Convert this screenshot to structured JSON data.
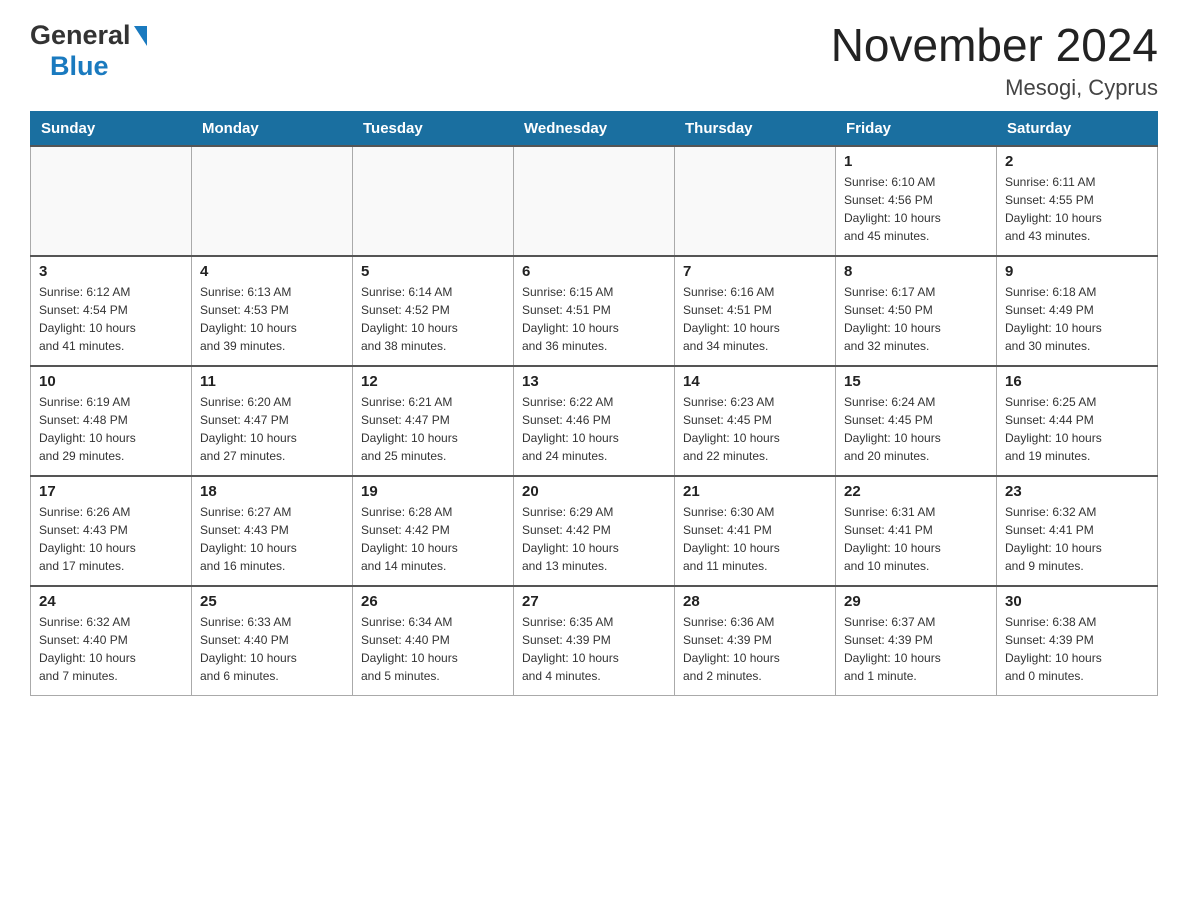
{
  "header": {
    "logo_general": "General",
    "logo_blue": "Blue",
    "month_title": "November 2024",
    "location": "Mesogi, Cyprus"
  },
  "days_of_week": [
    "Sunday",
    "Monday",
    "Tuesday",
    "Wednesday",
    "Thursday",
    "Friday",
    "Saturday"
  ],
  "weeks": [
    [
      {
        "day": "",
        "info": ""
      },
      {
        "day": "",
        "info": ""
      },
      {
        "day": "",
        "info": ""
      },
      {
        "day": "",
        "info": ""
      },
      {
        "day": "",
        "info": ""
      },
      {
        "day": "1",
        "info": "Sunrise: 6:10 AM\nSunset: 4:56 PM\nDaylight: 10 hours\nand 45 minutes."
      },
      {
        "day": "2",
        "info": "Sunrise: 6:11 AM\nSunset: 4:55 PM\nDaylight: 10 hours\nand 43 minutes."
      }
    ],
    [
      {
        "day": "3",
        "info": "Sunrise: 6:12 AM\nSunset: 4:54 PM\nDaylight: 10 hours\nand 41 minutes."
      },
      {
        "day": "4",
        "info": "Sunrise: 6:13 AM\nSunset: 4:53 PM\nDaylight: 10 hours\nand 39 minutes."
      },
      {
        "day": "5",
        "info": "Sunrise: 6:14 AM\nSunset: 4:52 PM\nDaylight: 10 hours\nand 38 minutes."
      },
      {
        "day": "6",
        "info": "Sunrise: 6:15 AM\nSunset: 4:51 PM\nDaylight: 10 hours\nand 36 minutes."
      },
      {
        "day": "7",
        "info": "Sunrise: 6:16 AM\nSunset: 4:51 PM\nDaylight: 10 hours\nand 34 minutes."
      },
      {
        "day": "8",
        "info": "Sunrise: 6:17 AM\nSunset: 4:50 PM\nDaylight: 10 hours\nand 32 minutes."
      },
      {
        "day": "9",
        "info": "Sunrise: 6:18 AM\nSunset: 4:49 PM\nDaylight: 10 hours\nand 30 minutes."
      }
    ],
    [
      {
        "day": "10",
        "info": "Sunrise: 6:19 AM\nSunset: 4:48 PM\nDaylight: 10 hours\nand 29 minutes."
      },
      {
        "day": "11",
        "info": "Sunrise: 6:20 AM\nSunset: 4:47 PM\nDaylight: 10 hours\nand 27 minutes."
      },
      {
        "day": "12",
        "info": "Sunrise: 6:21 AM\nSunset: 4:47 PM\nDaylight: 10 hours\nand 25 minutes."
      },
      {
        "day": "13",
        "info": "Sunrise: 6:22 AM\nSunset: 4:46 PM\nDaylight: 10 hours\nand 24 minutes."
      },
      {
        "day": "14",
        "info": "Sunrise: 6:23 AM\nSunset: 4:45 PM\nDaylight: 10 hours\nand 22 minutes."
      },
      {
        "day": "15",
        "info": "Sunrise: 6:24 AM\nSunset: 4:45 PM\nDaylight: 10 hours\nand 20 minutes."
      },
      {
        "day": "16",
        "info": "Sunrise: 6:25 AM\nSunset: 4:44 PM\nDaylight: 10 hours\nand 19 minutes."
      }
    ],
    [
      {
        "day": "17",
        "info": "Sunrise: 6:26 AM\nSunset: 4:43 PM\nDaylight: 10 hours\nand 17 minutes."
      },
      {
        "day": "18",
        "info": "Sunrise: 6:27 AM\nSunset: 4:43 PM\nDaylight: 10 hours\nand 16 minutes."
      },
      {
        "day": "19",
        "info": "Sunrise: 6:28 AM\nSunset: 4:42 PM\nDaylight: 10 hours\nand 14 minutes."
      },
      {
        "day": "20",
        "info": "Sunrise: 6:29 AM\nSunset: 4:42 PM\nDaylight: 10 hours\nand 13 minutes."
      },
      {
        "day": "21",
        "info": "Sunrise: 6:30 AM\nSunset: 4:41 PM\nDaylight: 10 hours\nand 11 minutes."
      },
      {
        "day": "22",
        "info": "Sunrise: 6:31 AM\nSunset: 4:41 PM\nDaylight: 10 hours\nand 10 minutes."
      },
      {
        "day": "23",
        "info": "Sunrise: 6:32 AM\nSunset: 4:41 PM\nDaylight: 10 hours\nand 9 minutes."
      }
    ],
    [
      {
        "day": "24",
        "info": "Sunrise: 6:32 AM\nSunset: 4:40 PM\nDaylight: 10 hours\nand 7 minutes."
      },
      {
        "day": "25",
        "info": "Sunrise: 6:33 AM\nSunset: 4:40 PM\nDaylight: 10 hours\nand 6 minutes."
      },
      {
        "day": "26",
        "info": "Sunrise: 6:34 AM\nSunset: 4:40 PM\nDaylight: 10 hours\nand 5 minutes."
      },
      {
        "day": "27",
        "info": "Sunrise: 6:35 AM\nSunset: 4:39 PM\nDaylight: 10 hours\nand 4 minutes."
      },
      {
        "day": "28",
        "info": "Sunrise: 6:36 AM\nSunset: 4:39 PM\nDaylight: 10 hours\nand 2 minutes."
      },
      {
        "day": "29",
        "info": "Sunrise: 6:37 AM\nSunset: 4:39 PM\nDaylight: 10 hours\nand 1 minute."
      },
      {
        "day": "30",
        "info": "Sunrise: 6:38 AM\nSunset: 4:39 PM\nDaylight: 10 hours\nand 0 minutes."
      }
    ]
  ]
}
